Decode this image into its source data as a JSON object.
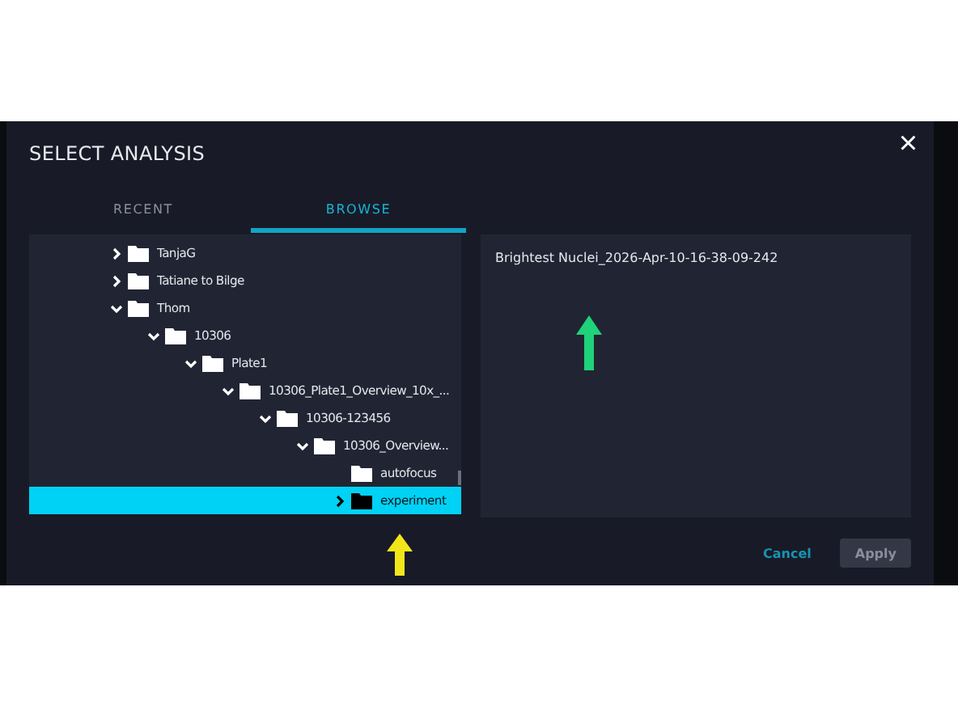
{
  "dialog": {
    "title": "SELECT ANALYSIS",
    "close": "×"
  },
  "tabs": [
    {
      "label": "RECENT",
      "selected": false
    },
    {
      "label": "BROWSE",
      "selected": true
    }
  ],
  "tree": [
    {
      "label": "TanjaG",
      "kind": "branch",
      "expanded": false,
      "selected": false
    },
    {
      "label": "Tatiane to Bilge",
      "kind": "branch",
      "expanded": false,
      "selected": false
    },
    {
      "label": "Thom",
      "kind": "branch",
      "expanded": true,
      "selected": false,
      "children": [
        {
          "label": "10306",
          "kind": "branch",
          "expanded": true,
          "selected": false,
          "children": [
            {
              "label": "Plate1",
              "kind": "branch",
              "expanded": true,
              "selected": false,
              "children": [
                {
                  "label": "10306_Plate1_Overview_10x_...",
                  "kind": "branch",
                  "expanded": true,
                  "selected": false,
                  "children": [
                    {
                      "label": "10306-123456",
                      "kind": "branch",
                      "expanded": true,
                      "selected": false,
                      "children": [
                        {
                          "label": "10306_Overview...",
                          "kind": "branch",
                          "expanded": true,
                          "selected": false,
                          "children": [
                            {
                              "label": "autofocus",
                              "kind": "leaf",
                              "selected": false
                            },
                            {
                              "label": "experiment",
                              "kind": "branch",
                              "expanded": false,
                              "selected": true
                            }
                          ]
                        }
                      ]
                    }
                  ]
                }
              ]
            }
          ]
        }
      ]
    }
  ],
  "analyses": [
    {
      "label": "Brightest Nuclei_2026-Apr-10-16-38-09-242"
    }
  ],
  "buttons": [
    {
      "label": "Cancel",
      "kind": "text",
      "disabled": false
    },
    {
      "label": "Apply",
      "kind": "filled",
      "disabled": true
    }
  ]
}
